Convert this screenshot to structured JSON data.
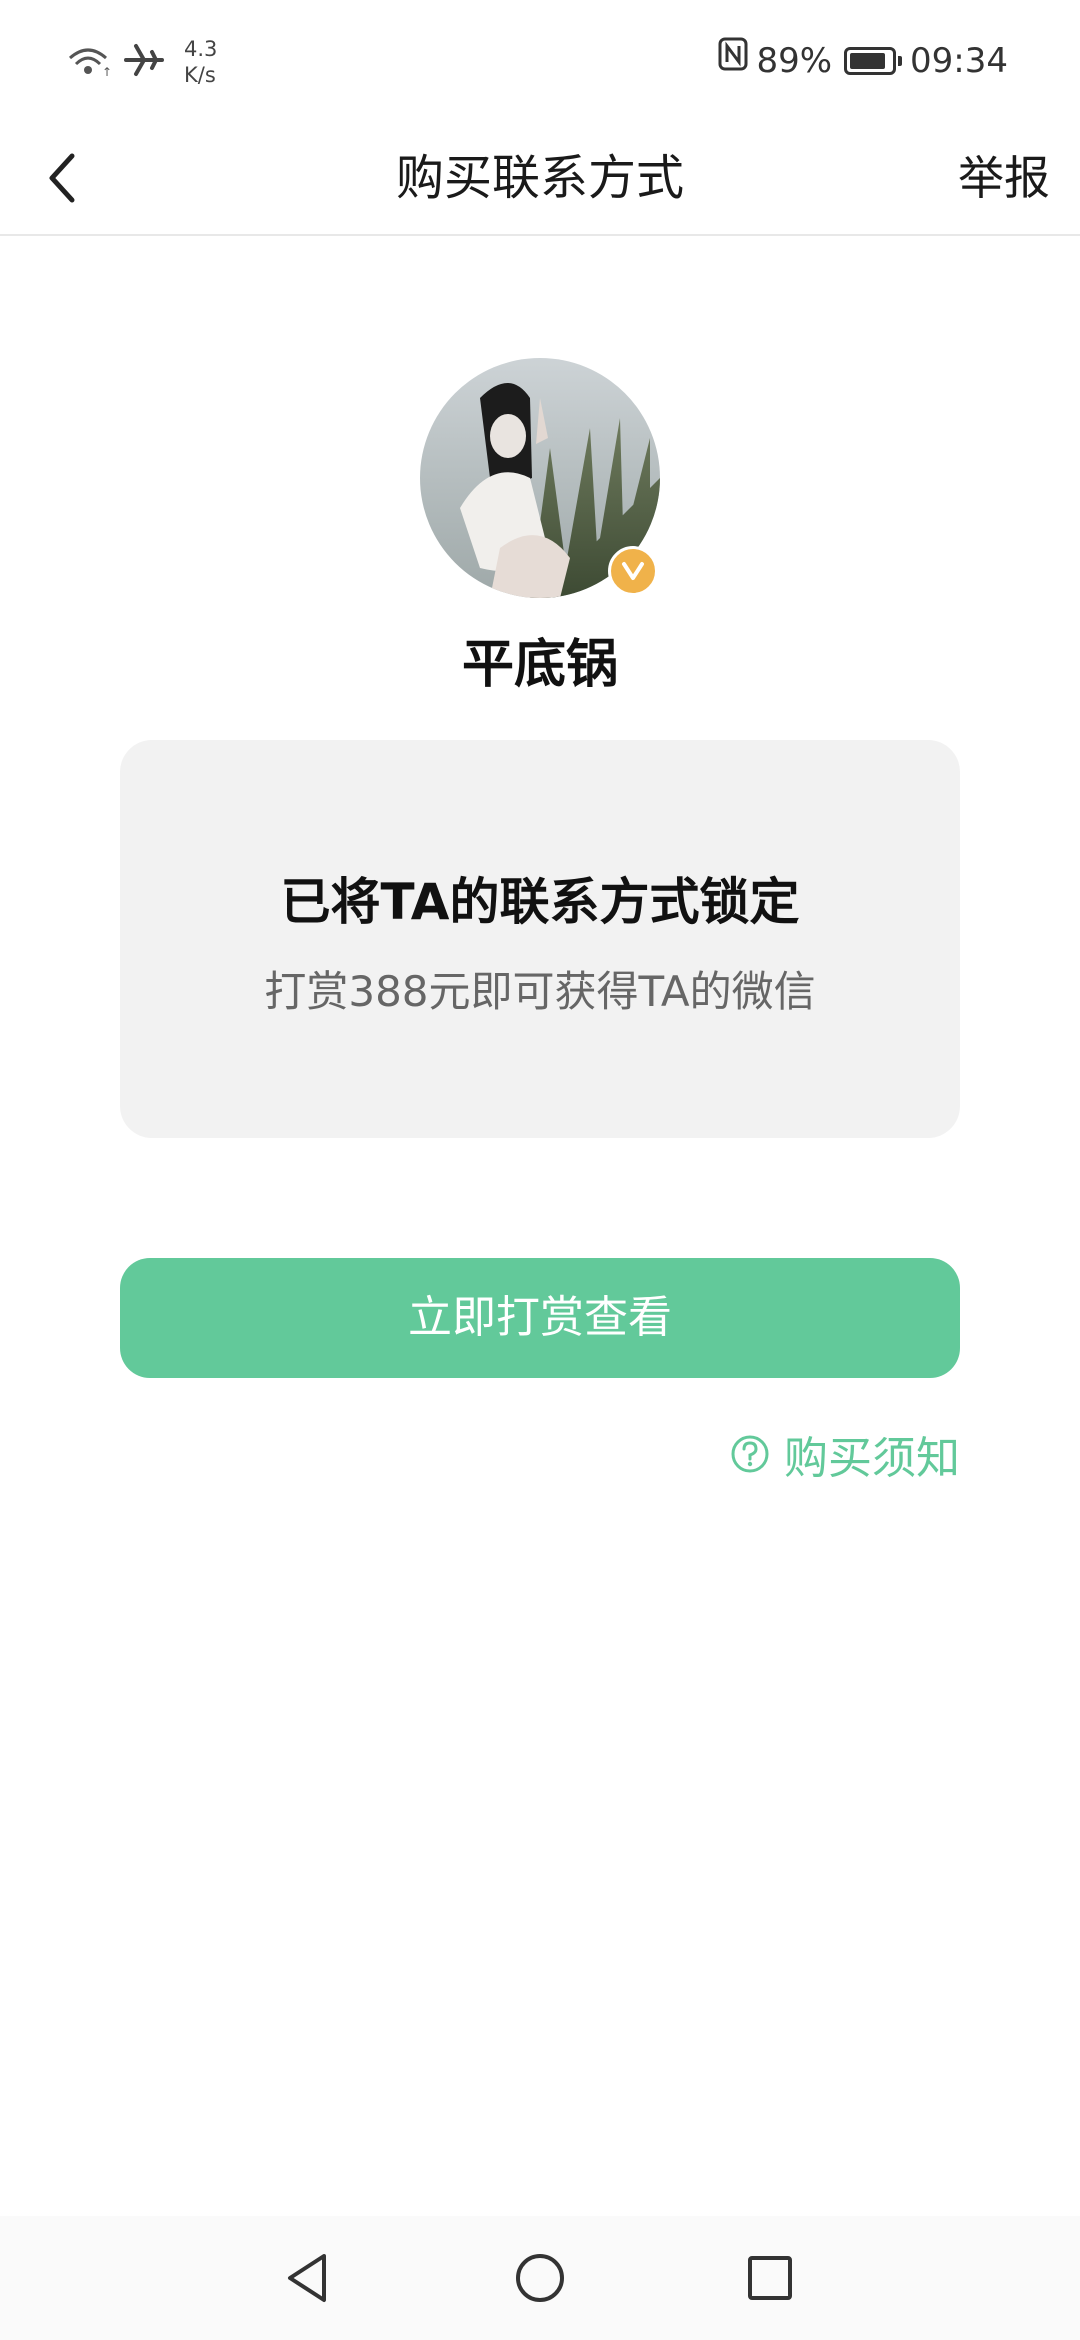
{
  "status_bar": {
    "net_speed_value": "4.3",
    "net_speed_unit": "K/s",
    "battery_percent": "89%",
    "battery_level": 0.89,
    "time": "09:34"
  },
  "nav": {
    "title": "购买联系方式",
    "report_label": "举报"
  },
  "profile": {
    "username": "平底锅",
    "verified": true
  },
  "lock_card": {
    "title": "已将TA的联系方式锁定",
    "subtitle": "打赏388元即可获得TA的微信"
  },
  "actions": {
    "reward_button_label": "立即打赏查看",
    "purchase_notice_label": "购买须知"
  },
  "colors": {
    "accent": "#62c99a",
    "badge": "#f0b24a",
    "card_bg": "#f2f2f2"
  }
}
